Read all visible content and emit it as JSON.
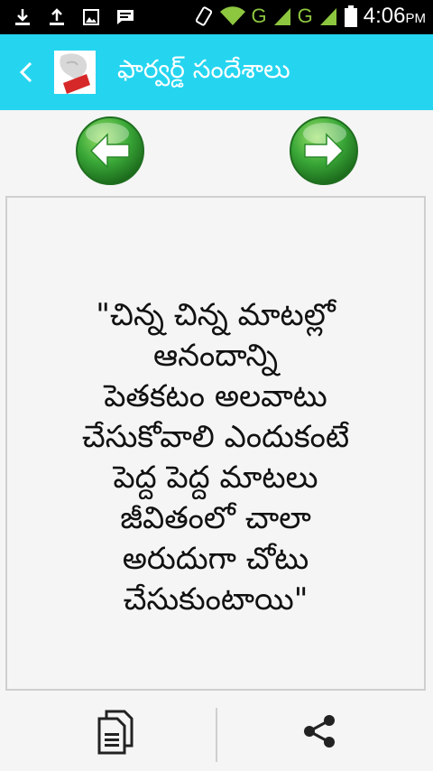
{
  "status_bar": {
    "time": "4:06",
    "ampm": "PM",
    "network_1": "G",
    "network_2": "G",
    "icons": [
      "download-icon",
      "upload-icon",
      "image-icon",
      "chat-icon",
      "vibrate-icon",
      "wifi-icon",
      "signal-icon",
      "battery-icon"
    ]
  },
  "app_bar": {
    "title": "ఫార్వర్డ్ సందేశాలు"
  },
  "message": {
    "lines": [
      "\"చిన్న చిన్న మాటల్లో",
      "ఆనందాన్ని",
      "పెతకటం అలవాటు",
      "చేసుకోవాలి ఎందుకంటే",
      "పెద్ద పెద్ద మాటలు",
      "జీవితంలో చాలా",
      "అరుదుగా చోటు",
      "చేసుకుంటాయి\""
    ]
  },
  "colors": {
    "app_bar": "#25d5f0",
    "nav_button": "#3aa838",
    "background": "#f5f5f5"
  },
  "actions": {
    "prev": "arrow-left-icon",
    "next": "arrow-right-icon",
    "copy": "copy-icon",
    "share": "share-icon"
  }
}
